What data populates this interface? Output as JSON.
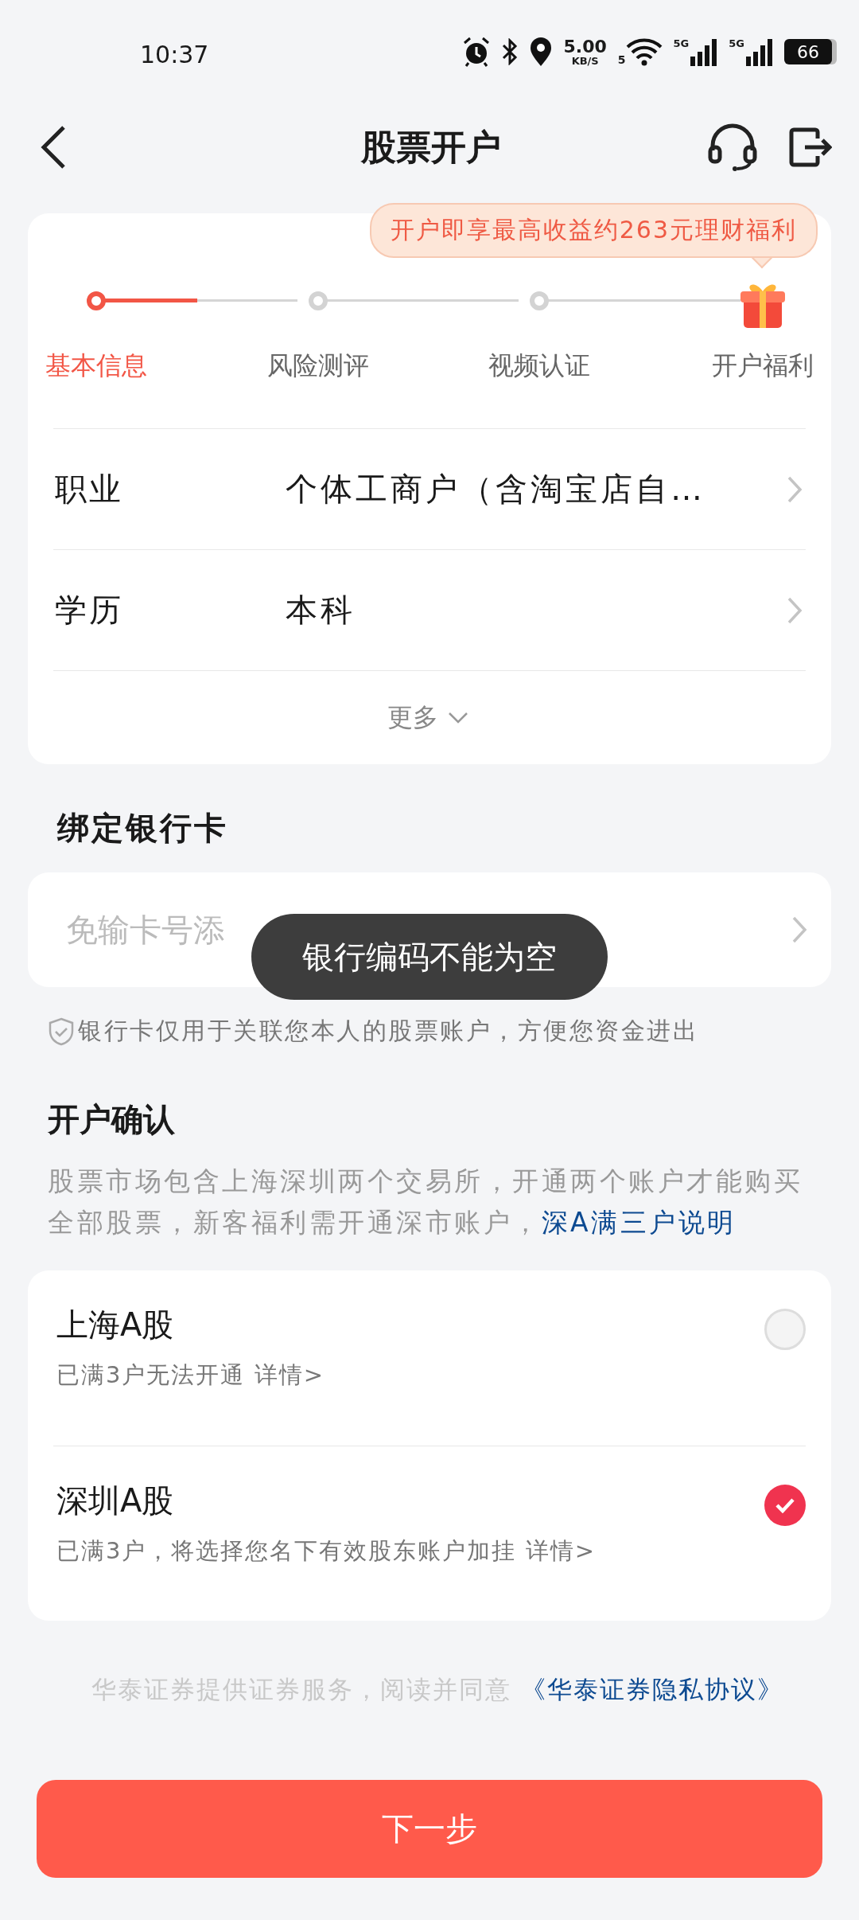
{
  "status_bar": {
    "time": "10:37",
    "net_speed": "5.00",
    "net_unit": "KB/S",
    "wifi_label": "5",
    "sims": [
      "5G",
      "5G"
    ],
    "battery": "66"
  },
  "header": {
    "title": "股票开户"
  },
  "steps": {
    "promo": "开户即享最高收益约263元理财福利",
    "items": [
      {
        "label": "基本信息",
        "selected": true,
        "kind": "dot"
      },
      {
        "label": "风险测评",
        "selected": false,
        "kind": "dot"
      },
      {
        "label": "视频认证",
        "selected": false,
        "kind": "dot"
      },
      {
        "label": "开户福利",
        "selected": false,
        "kind": "gift"
      }
    ]
  },
  "info_rows": [
    {
      "label": "职业",
      "value": "个体工商户（含淘宝店自…"
    },
    {
      "label": "学历",
      "value": "本科"
    }
  ],
  "more": "更多",
  "bank": {
    "heading": "绑定银行卡",
    "placeholder": "免输卡号添",
    "toast": "银行编码不能为空",
    "note": "银行卡仅用于关联您本人的股票账户，方便您资金进出"
  },
  "confirm": {
    "heading": "开户确认",
    "description": "股票市场包含上海深圳两个交易所，开通两个账户才能购买全部股票，新客福利需开通深市账户，",
    "link": "深A满三户说明"
  },
  "markets": [
    {
      "name": "上海A股",
      "note": "已满3户无法开通",
      "detail": "详情>",
      "selected": false
    },
    {
      "name": "深圳A股",
      "note": "已满3户，将选择您名下有效股东账户加挂",
      "detail": "详情>",
      "selected": true
    }
  ],
  "agreement": {
    "text": "华泰证券提供证券服务，阅读并同意",
    "link": "《华泰证券隐私协议》"
  },
  "next_button": "下一步"
}
